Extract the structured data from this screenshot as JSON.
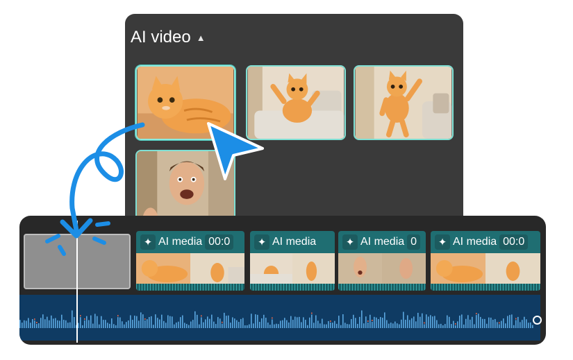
{
  "panel": {
    "title": "AI video",
    "caret_icon": "caret-up-icon",
    "thumbnails": [
      {
        "subject": "orange cat lying",
        "selected": true
      },
      {
        "subject": "orange cat standing on sofa",
        "selected": false
      },
      {
        "subject": "orange cat dancing",
        "selected": false
      },
      {
        "subject": "surprised man",
        "selected": false
      }
    ]
  },
  "timeline": {
    "clips": [
      {
        "icon": "sparkle-icon",
        "label": "AI media",
        "time": "00:0"
      },
      {
        "icon": "sparkle-icon",
        "label": "AI media",
        "time": ""
      },
      {
        "icon": "sparkle-icon",
        "label": "AI media",
        "time": "0"
      },
      {
        "icon": "sparkle-icon",
        "label": "AI media",
        "time": "00:0"
      }
    ]
  },
  "colors": {
    "panel_bg": "#3a3a3a",
    "selection_border": "#7fe0d4",
    "clip_bg": "#1f6e72",
    "audio_bg": "#0f3b63",
    "cursor": "#1c8ee6"
  }
}
